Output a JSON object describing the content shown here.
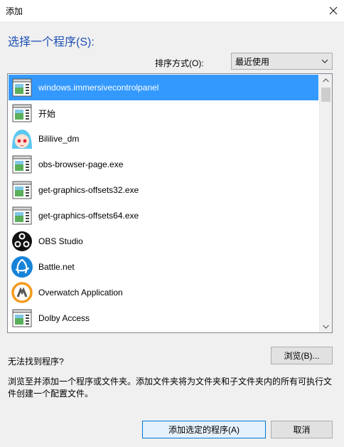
{
  "window": {
    "title": "添加",
    "close_icon": "close-icon"
  },
  "heading": "选择一个程序(S):",
  "sort": {
    "label": "排序方式(O):",
    "value": "最近使用"
  },
  "programs": [
    {
      "name": "windows.immersivecontrolpanel",
      "icon": "app-window-icon",
      "selected": true
    },
    {
      "name": "开始",
      "icon": "app-window-icon",
      "selected": false
    },
    {
      "name": "Bililive_dm",
      "icon": "bililive-avatar-icon",
      "selected": false
    },
    {
      "name": "obs-browser-page.exe",
      "icon": "app-window-icon",
      "selected": false
    },
    {
      "name": "get-graphics-offsets32.exe",
      "icon": "app-window-icon",
      "selected": false
    },
    {
      "name": "get-graphics-offsets64.exe",
      "icon": "app-window-icon",
      "selected": false
    },
    {
      "name": "OBS Studio",
      "icon": "obs-studio-icon",
      "selected": false
    },
    {
      "name": "Battle.net",
      "icon": "battlenet-icon",
      "selected": false
    },
    {
      "name": "Overwatch Application",
      "icon": "overwatch-icon",
      "selected": false
    },
    {
      "name": "Dolby Access",
      "icon": "app-window-icon",
      "selected": false
    }
  ],
  "not_found": "无法找到程序?",
  "browse_label": "浏览(B)...",
  "description": "浏览至并添加一个程序或文件夹。添加文件夹将为文件夹和子文件夹内的所有可执行文件创建一个配置文件。",
  "buttons": {
    "add": "添加选定的程序(A)",
    "cancel": "取消"
  },
  "colors": {
    "selection": "#3399ff",
    "heading": "#1e50b4",
    "default_border": "#0078d7"
  }
}
